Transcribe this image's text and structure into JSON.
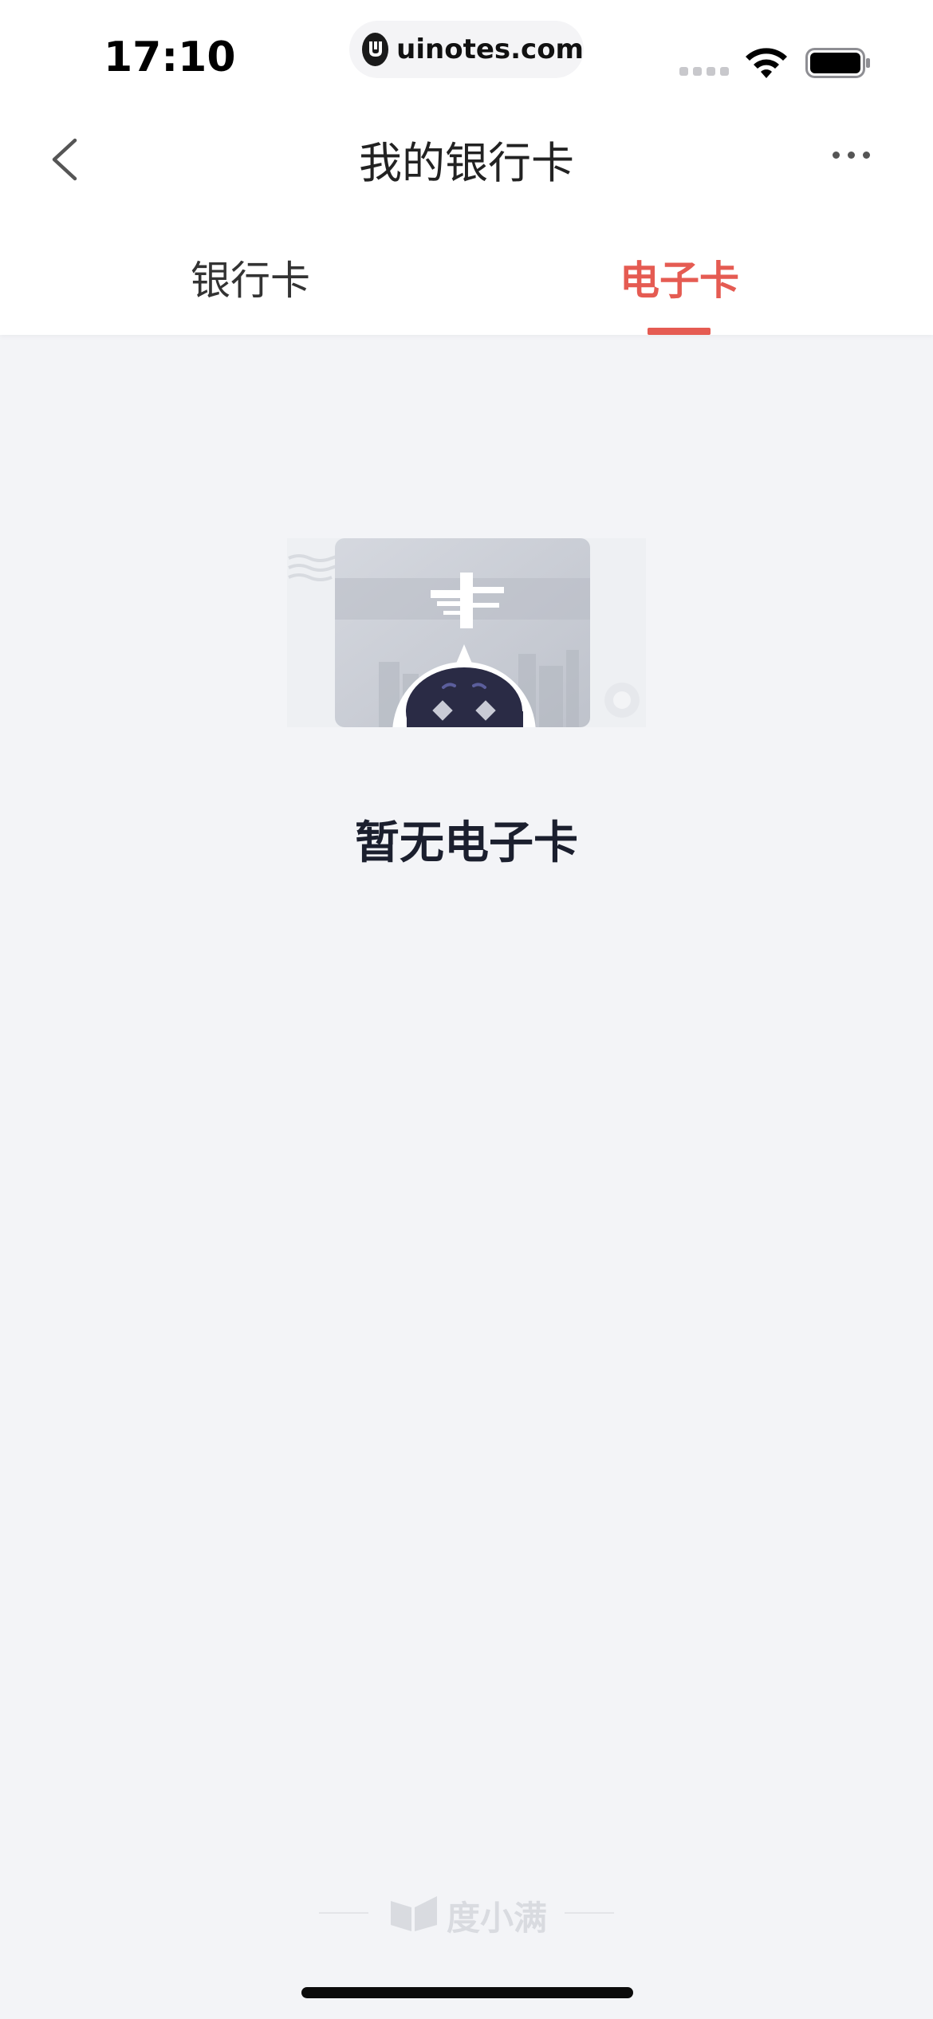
{
  "status_bar": {
    "time": "17:10",
    "url": "uinotes.com",
    "icons": [
      "signal-icon",
      "wifi-icon",
      "battery-icon"
    ]
  },
  "nav": {
    "title": "我的银行卡",
    "back_icon": "chevron-left-icon",
    "more_icon": "more-dots-icon"
  },
  "tabs": [
    {
      "label": "银行卡",
      "active": false
    },
    {
      "label": "电子卡",
      "active": true
    }
  ],
  "empty_state": {
    "illustration": "empty-card-robot-illustration",
    "message": "暂无电子卡"
  },
  "footer": {
    "brand": "度小满",
    "logo_icon": "du-xiaoman-logo-icon"
  },
  "colors": {
    "accent": "#E55B52",
    "background": "#F3F4F7",
    "header": "#FFFFFF",
    "title_text": "#1B1F2E"
  }
}
